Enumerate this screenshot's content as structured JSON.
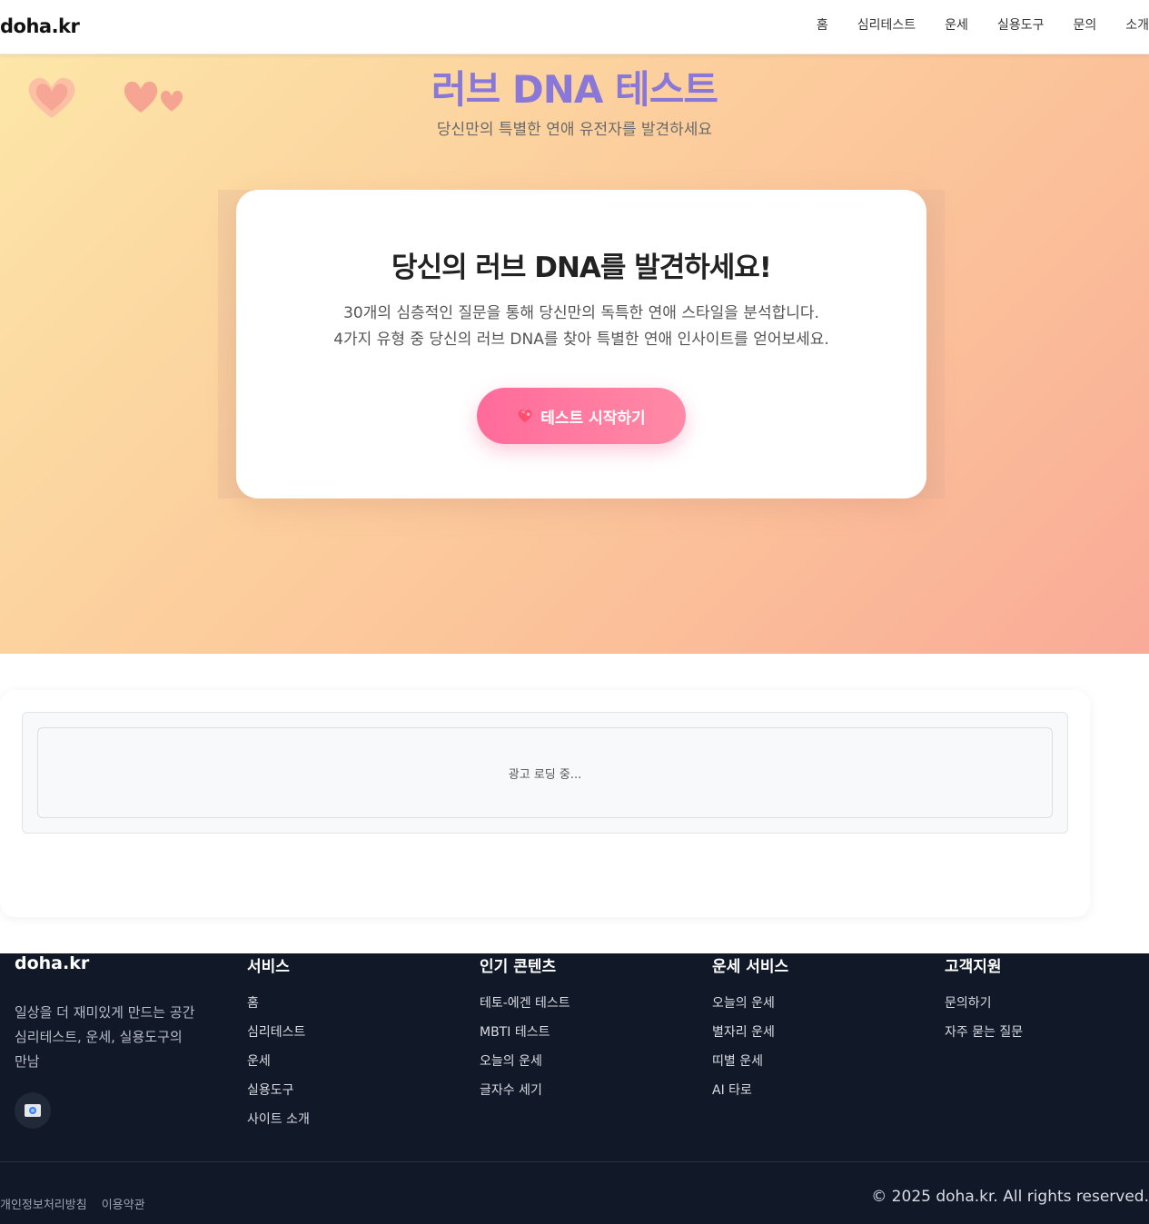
{
  "header": {
    "logo": "doha.kr",
    "nav": [
      "홈",
      "심리테스트",
      "운세",
      "실용도구",
      "문의",
      "소개"
    ]
  },
  "hero": {
    "title": "러브 DNA 테스트",
    "subtitle": "당신만의 특별한 연애 유전자를 발견하세요"
  },
  "card": {
    "title": "당신의 러브 DNA를 발견하세요!",
    "desc_line1": "30개의 심층적인 질문을 통해 당신만의 독특한 연애 스타일을 분석합니다.",
    "desc_line2": "4가지 유형 중 당신의 러브 DNA를 찾아 특별한 연애 인사이트를 얻어보세요.",
    "button_label": "테스트 시작하기",
    "button_icon": "heart-icon"
  },
  "ad": {
    "loading_text": "광고 로딩 중..."
  },
  "footer": {
    "brand": "doha.kr",
    "desc_line1": "일상을 더 재미있게 만드는 공간",
    "desc_line2": "심리테스트, 운세, 실용도구의",
    "desc_line3": "만남",
    "columns": [
      {
        "heading": "서비스",
        "links": [
          "홈",
          "심리테스트",
          "운세",
          "실용도구",
          "사이트 소개"
        ]
      },
      {
        "heading": "인기 콘텐츠",
        "links": [
          "테토-에겐 테스트",
          "MBTI 테스트",
          "오늘의 운세",
          "글자수 세기"
        ]
      },
      {
        "heading": "운세 서비스",
        "links": [
          "오늘의 운세",
          "별자리 운세",
          "띠별 운세",
          "AI 타로"
        ]
      },
      {
        "heading": "고객지원",
        "links": [
          "문의하기",
          "자주 묻는 질문"
        ]
      }
    ],
    "bottom_links": [
      "개인정보처리방침",
      "이용약관"
    ],
    "copyright": "© 2025 doha.kr. All rights reserved."
  },
  "colors": {
    "title_purple": "#8a78d8",
    "button_pink": "#ff6b9b",
    "footer_bg": "#111827"
  }
}
